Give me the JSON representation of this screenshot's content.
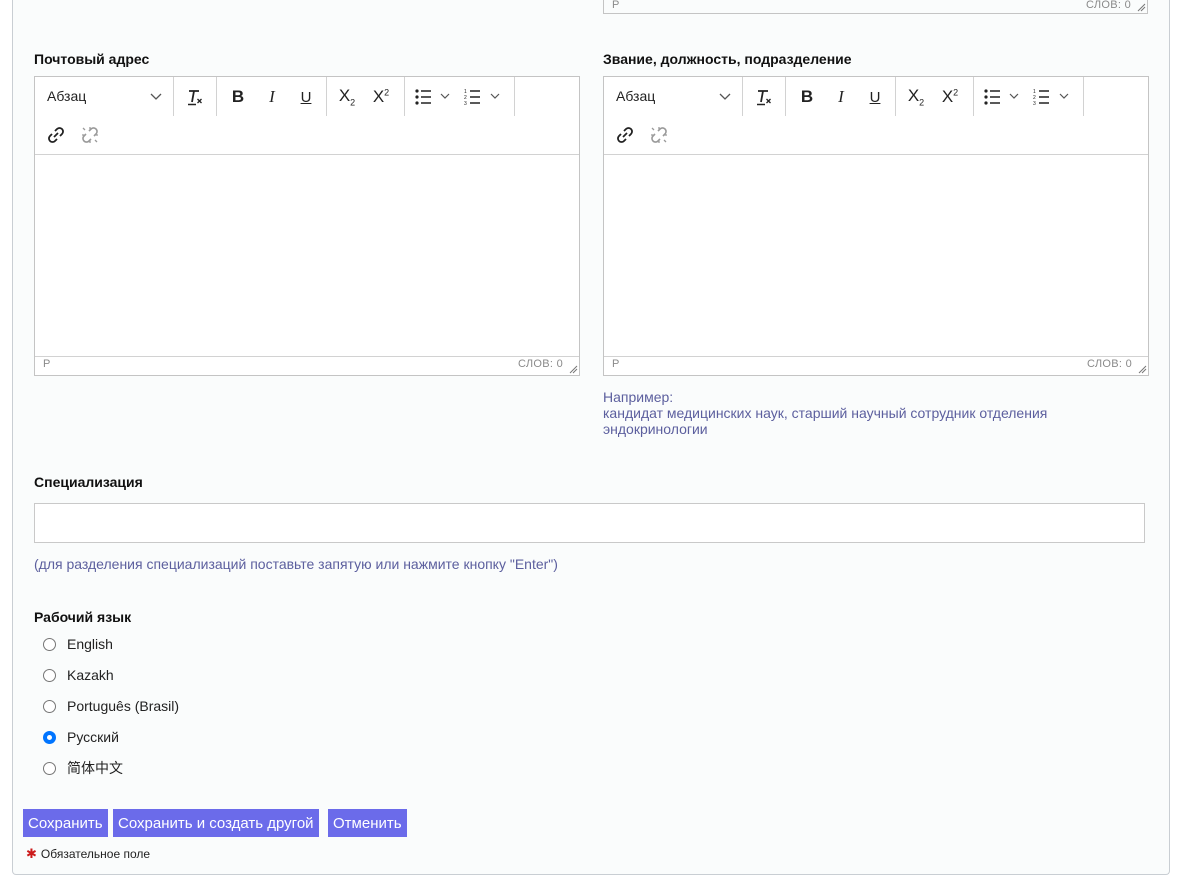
{
  "editor_common": {
    "format_label": "Абзац",
    "status_path": "P",
    "word_count": "СЛОВ: 0"
  },
  "postal_address": {
    "label": "Почтовый адрес"
  },
  "title_position": {
    "label": "Звание, должность, подразделение",
    "hint_line1": "Например:",
    "hint_line2": "кандидат медицинских наук, старший научный сотрудник отделения",
    "hint_line3": "эндокринологии"
  },
  "specialization": {
    "label": "Специализация",
    "value": "",
    "hint": "(для разделения специализаций поставьте запятую или нажмите кнопку \"Enter\")"
  },
  "working_language": {
    "label": "Рабочий язык",
    "options": [
      {
        "label": "English",
        "checked": false
      },
      {
        "label": "Kazakh",
        "checked": false
      },
      {
        "label": "Português (Brasil)",
        "checked": false
      },
      {
        "label": "Русский",
        "checked": true
      },
      {
        "label": "简体中文",
        "checked": false
      }
    ]
  },
  "buttons": {
    "save": "Сохранить",
    "save_and_create": "Сохранить и создать другой",
    "cancel": "Отменить"
  },
  "required_note": "Обязательное поле",
  "colors": {
    "button_bg": "#6b6bea",
    "hint_text": "#5c5f9e",
    "required_star": "#cc1b1b",
    "radio_checked": "#0075ff"
  }
}
